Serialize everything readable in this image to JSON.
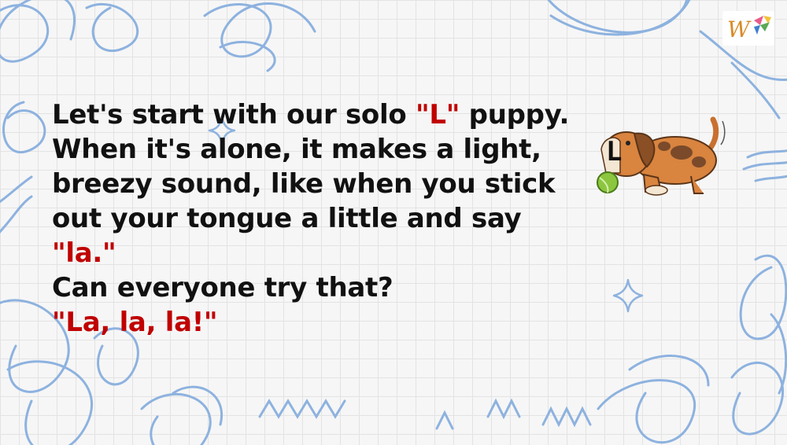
{
  "paragraph": {
    "line1_a": "Let's start with our solo ",
    "line1_b": "\"L\"",
    "line1_c": " puppy.",
    "line2": "When it's alone, it makes a light,",
    "line3": "breezy sound, like when you stick",
    "line4": "out your tongue a little and say",
    "line5": "\"la.\"",
    "line6": "Can everyone try that?",
    "line7": "\"La, la, la!\""
  },
  "colors": {
    "highlight": "#c00000",
    "text": "#111111",
    "scribble": "#7fa9d9"
  },
  "icons": {
    "logo": "w-logo-icon",
    "puppy": "puppy-with-ball-icon",
    "sparkle": "sparkle-icon"
  },
  "puppy_label": "L"
}
